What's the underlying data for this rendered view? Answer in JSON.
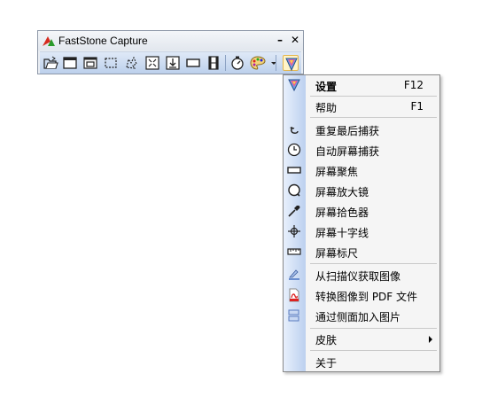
{
  "window": {
    "title": "FastStone Capture",
    "minimize_glyph": "–",
    "close_glyph": "✕"
  },
  "toolbar": {
    "tools": [
      {
        "name": "open-file-icon"
      },
      {
        "name": "capture-window-icon"
      },
      {
        "name": "capture-object-icon"
      },
      {
        "name": "capture-rectangle-icon"
      },
      {
        "name": "capture-freehand-icon"
      },
      {
        "name": "capture-fullscreen-icon"
      },
      {
        "name": "capture-scrolling-icon"
      },
      {
        "name": "capture-fixed-region-icon"
      },
      {
        "name": "screen-recorder-icon"
      },
      {
        "name": "delay-timer-icon"
      },
      {
        "name": "output-color-icon"
      },
      {
        "name": "settings-menu-icon"
      }
    ]
  },
  "menu": {
    "settings": {
      "label": "设置",
      "shortcut": "F12",
      "icon": "settings-icon"
    },
    "help": {
      "label": "帮助",
      "shortcut": "F1"
    },
    "group1": [
      {
        "label": "重复最后捕获",
        "icon": "repeat-capture-icon"
      },
      {
        "label": "自动屏幕捕获",
        "icon": "clock-icon"
      },
      {
        "label": "屏幕聚焦",
        "icon": "spotlight-icon"
      },
      {
        "label": "屏幕放大镜",
        "icon": "magnifier-icon"
      },
      {
        "label": "屏幕拾色器",
        "icon": "color-picker-icon"
      },
      {
        "label": "屏幕十字线",
        "icon": "crosshair-icon"
      },
      {
        "label": "屏幕标尺",
        "icon": "ruler-icon"
      }
    ],
    "group2": [
      {
        "label": "从扫描仪获取图像",
        "icon": "scanner-icon"
      },
      {
        "label": "转换图像到 PDF 文件",
        "icon": "pdf-icon"
      },
      {
        "label": "通过侧面加入图片",
        "icon": "join-images-icon"
      }
    ],
    "skin": {
      "label": "皮肤"
    },
    "about": {
      "label": "关于"
    }
  }
}
